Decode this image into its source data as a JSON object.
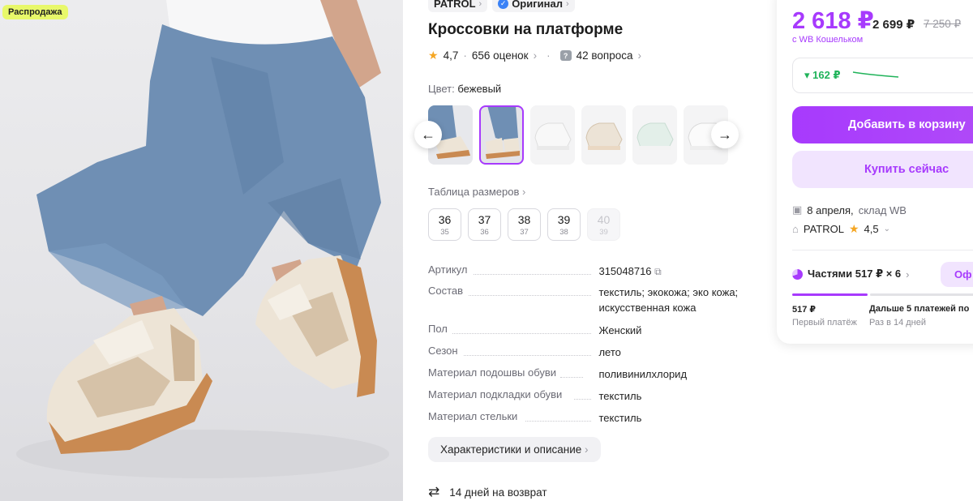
{
  "badge": {
    "sale": "Распродажа"
  },
  "brand": {
    "name": "PATROL",
    "original": "Оригинал"
  },
  "product": {
    "title": "Кроссовки на платформе",
    "rating": "4,7",
    "reviews": "656 оценок",
    "questions": "42 вопроса"
  },
  "color": {
    "label": "Цвет:",
    "value": "бежевый"
  },
  "sizes": {
    "table_label": "Таблица размеров",
    "items": [
      {
        "ru": "36",
        "eu": "35",
        "available": true
      },
      {
        "ru": "37",
        "eu": "36",
        "available": true
      },
      {
        "ru": "38",
        "eu": "37",
        "available": true
      },
      {
        "ru": "39",
        "eu": "38",
        "available": true
      },
      {
        "ru": "40",
        "eu": "39",
        "available": false
      }
    ]
  },
  "specs": [
    {
      "key": "Артикул",
      "value": "315048716"
    },
    {
      "key": "Состав",
      "value": "текстиль; экокожа; эко кожа; искусственная кожа"
    },
    {
      "key": "Пол",
      "value": "Женский"
    },
    {
      "key": "Сезон",
      "value": "лето"
    },
    {
      "key": "Материал подошвы обуви",
      "value": "поливинилхлорид"
    },
    {
      "key": "Материал подкладки обуви",
      "value": "текстиль"
    },
    {
      "key": "Материал стельки",
      "value": "текстиль"
    }
  ],
  "description_button": "Характеристики и описание",
  "return_policy": "14 дней на возврат",
  "price": {
    "main": "2 618 ₽",
    "alt": "2 699 ₽",
    "old": "7 250 ₽",
    "wallet_note": "с WB Кошельком",
    "drop": "▾ 162 ₽"
  },
  "buttons": {
    "cart": "Добавить в корзину",
    "buy": "Купить сейчас"
  },
  "delivery": {
    "date": "8 апреля,",
    "warehouse": "склад WB"
  },
  "seller": {
    "name": "PATROL",
    "rating": "4,5"
  },
  "installments": {
    "label": "Частями 517 ₽ × 6",
    "offer": "Оф",
    "first_amount": "517 ₽",
    "first_label": "Первый платёж",
    "next_amount": "Дальше 5 платежей по",
    "next_label": "Раз в 14 дней"
  },
  "colors": {
    "accent": "#a73afd",
    "green": "#20b35a",
    "badge": "#e8f86a"
  }
}
